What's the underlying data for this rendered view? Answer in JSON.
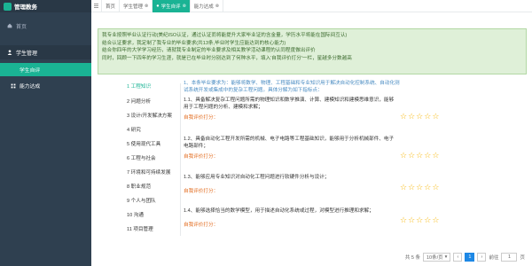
{
  "app": {
    "title": "管理教务"
  },
  "sidebar": {
    "home": "首页",
    "group": "学生管理",
    "items": [
      {
        "label": "学生自评"
      },
      {
        "label": "能力达成"
      }
    ]
  },
  "tabs": [
    {
      "label": "首页"
    },
    {
      "label": "学生管理"
    },
    {
      "label": "学生自评"
    },
    {
      "label": "能力达成"
    }
  ],
  "notice": {
    "lines": [
      "我专业按照毕业认证行动(美纪ISO认证，通过认证而将能提升大家毕业证的含金量，学历水平将能在国际间互认)",
      "结合认证要求，我定制了我专业的毕业要求(共13条,毕业时学生应能达到的核心能力)",
      "结合你四年的大学学习经历，请就我专业制定的毕业要求及相关教学活动课程的认同程度做出评价",
      "同时，回顾一下四年的学习生涯，就是已在毕业时分别达到了何种水平，填入'自我评价打分'一栏，星越多分数越高"
    ]
  },
  "outcomes": [
    "1 工程知识",
    "2 问题分析",
    "3 设计/开发解决方案",
    "4 研究",
    "5 使用现代工具",
    "6 工程与社会",
    "7 环境和可持续发展",
    "8 职业规范",
    "9 个人与团队",
    "10 沟通",
    "11 项目管理"
  ],
  "description": {
    "lines": [
      "1、本条毕业要求为：能够将数学、物理、工程基础和专业知识用于解决自动化控制系统、自动化测",
      "试系统开发或集成中的复杂工程问题。具体分解为如下指标点："
    ]
  },
  "requirements": [
    {
      "lines": [
        "1.1、具备解决复杂工程问题所需的物理知识和数学推演、计算、建模知识和建模思维意识，能够",
        "用于工程问题的分析、建模和求解；"
      ],
      "eval_label": "自我评价打分：",
      "stars": 5
    },
    {
      "lines": [
        "1.2、具备自动化工程开发所需的机械、电子电路等工程基础知识，能够用于分析机械部件、电子",
        "电路部件；"
      ],
      "eval_label": "自我评价打分：",
      "stars": 5
    },
    {
      "lines": [
        "1.3、能够应用专业知识对自动化工程问题进行软硬件分析与设计；"
      ],
      "eval_label": "自我评价打分：",
      "stars": 5
    },
    {
      "lines": [
        "1.4、能够选择恰当的数学模型，用于描述自动化系统或过程，对模型进行推理和求解；"
      ],
      "eval_label": "自我评价打分：",
      "stars": 5
    }
  ],
  "pager": {
    "total": "共 5 条",
    "page_size": "10条/页",
    "prev": "‹",
    "current": "1",
    "next": "›",
    "goto_label": "前往",
    "goto_value": "1",
    "page_unit": "页"
  }
}
